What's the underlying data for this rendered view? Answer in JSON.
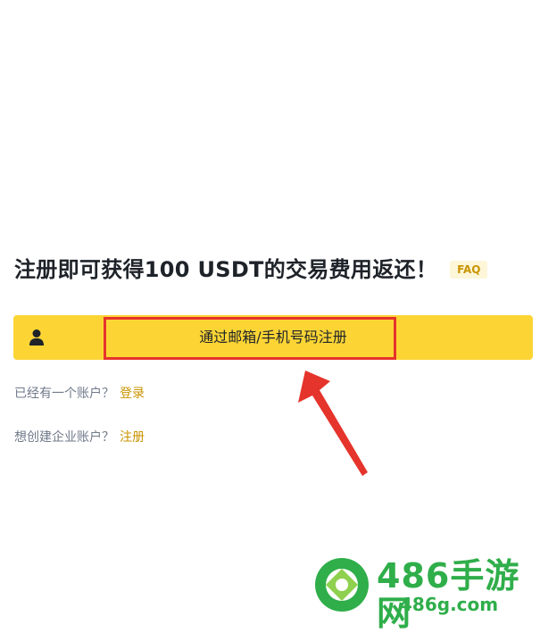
{
  "headline": "注册即可获得100 USDT的交易费用返还！",
  "faq_badge": "FAQ",
  "register": {
    "label": "通过邮箱/手机号码注册",
    "icon": "person-icon"
  },
  "login_line": {
    "text": "已经有一个账户？",
    "link": "登录"
  },
  "enterprise_line": {
    "text": "想创建企业账户？",
    "link": "注册"
  },
  "colors": {
    "accent": "#fcd535",
    "link": "#c99400",
    "annotation": "#e5342b",
    "watermark": "#2fae4a"
  },
  "watermark": {
    "title": "486手游网",
    "domain": "486g.com"
  }
}
